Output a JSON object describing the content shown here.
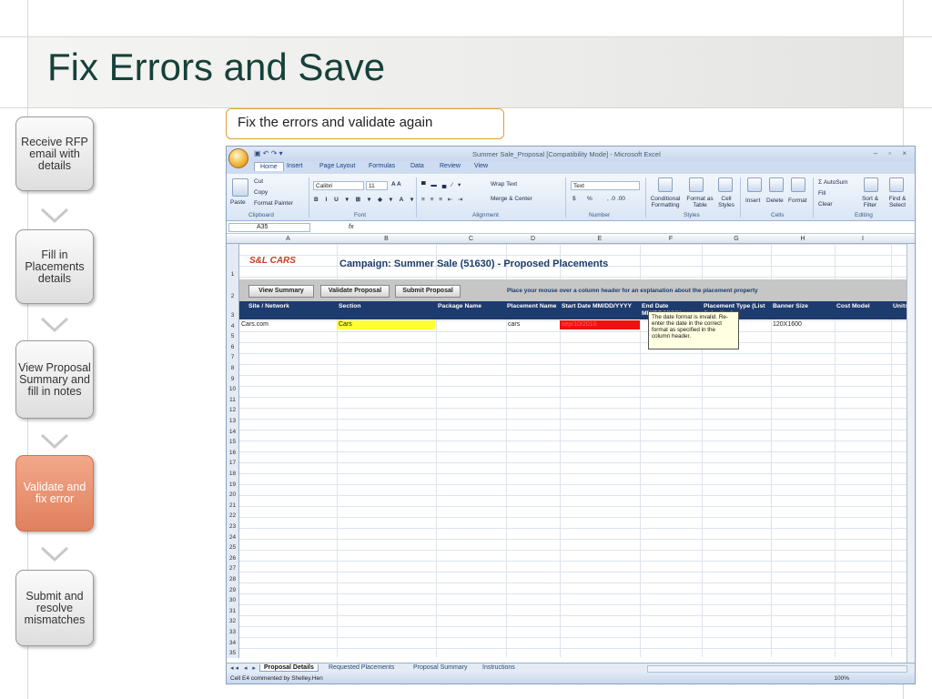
{
  "slide": {
    "title": "Fix Errors and Save",
    "callout": "Fix the errors and validate again"
  },
  "steps": [
    {
      "label": "Receive RFP email with details",
      "active": false
    },
    {
      "label": "Fill in Placements details",
      "active": false
    },
    {
      "label": "View Proposal Summary and fill in notes",
      "active": false
    },
    {
      "label": "Validate and fix error",
      "active": true
    },
    {
      "label": "Submit and resolve mismatches",
      "active": false
    }
  ],
  "excel": {
    "window_title": "Summer Sale_Proposal  [Compatibility Mode] - Microsoft Excel",
    "tabs": [
      "Home",
      "Insert",
      "Page Layout",
      "Formulas",
      "Data",
      "Review",
      "View"
    ],
    "ribbon": {
      "clipboard": {
        "paste": "Paste",
        "cut": "Cut",
        "copy": "Copy",
        "format_painter": "Format Painter",
        "label": "Clipboard"
      },
      "font": {
        "name": "Calibri",
        "size": "11",
        "label": "Font"
      },
      "alignment": {
        "wrap": "Wrap Text",
        "merge": "Merge & Center",
        "label": "Alignment"
      },
      "number": {
        "format": "Text",
        "currency": "$",
        "percent": "%",
        "label": "Number"
      },
      "styles": {
        "conditional": "Conditional Formatting",
        "as_table": "Format as Table",
        "cell_styles": "Cell Styles",
        "label": "Styles"
      },
      "cells": {
        "insert": "Insert",
        "delete": "Delete",
        "format": "Format",
        "label": "Cells"
      },
      "editing": {
        "autosum": "AutoSum",
        "fill": "Fill",
        "clear": "Clear",
        "sort": "Sort & Filter",
        "find": "Find & Select",
        "label": "Editing"
      }
    },
    "name_box": "A35",
    "fx": "fx",
    "columns": [
      "A",
      "B",
      "C",
      "D",
      "E",
      "F",
      "G",
      "H",
      "I"
    ],
    "rows": [
      "1",
      "2",
      "3",
      "4",
      "5",
      "6",
      "7",
      "8",
      "9",
      "10",
      "11",
      "12",
      "13",
      "14",
      "15",
      "16",
      "17",
      "18",
      "19",
      "20",
      "21",
      "22",
      "23",
      "24",
      "25",
      "26",
      "27",
      "28",
      "29",
      "30",
      "31",
      "32",
      "33",
      "34",
      "35"
    ],
    "logo_text": "S&L CARS",
    "campaign_title": "Campaign: Summer Sale (51630) - Proposed Placements",
    "buttons": {
      "view_summary": "View Summary",
      "validate": "Validate Proposal",
      "submit": "Submit Proposal"
    },
    "hint": "Place your mouse over a column header for an explanation about the placement property",
    "headers": {
      "site": "Site / Network",
      "section": "Section",
      "package": "Package Name",
      "placement": "Placement Name",
      "start": "Start Date MM/DD/YYYY",
      "end": "End Date MM/DD/YYYY",
      "type": "Placement Type (List Selection)",
      "banner": "Banner Size",
      "cost": "Cost Model",
      "units": "Units"
    },
    "row4": {
      "site": "Cars.com",
      "section": "Cars",
      "placement": "cars",
      "start": "sep/10/2010",
      "banner": "120X1600"
    },
    "tooltip": "The date format is invalid. Re-enter the date in the correct format as specified in the column header.",
    "sheet_tabs": [
      "Proposal Details",
      "Requested Placements",
      "Proposal Summary",
      "Instructions"
    ],
    "status_text": "Cell E4 commented by Shelley.Hen",
    "zoom": "100%",
    "colors": {
      "header_bg": "#1e3b6e",
      "error_red": "#ee1111",
      "highlight_yellow": "#ffff33"
    }
  }
}
